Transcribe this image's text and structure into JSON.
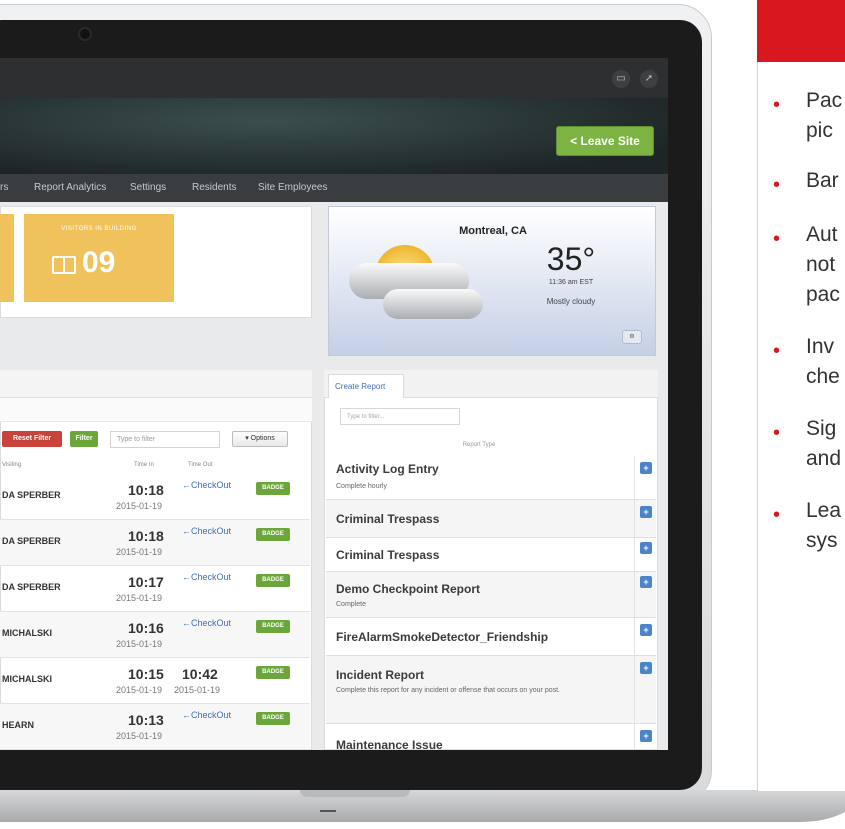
{
  "app": {
    "leave_button": "< Leave Site",
    "nav": [
      "rs",
      "Report Analytics",
      "Settings",
      "Residents",
      "Site Employees"
    ]
  },
  "stats": {
    "visitors_title": "VISITORS IN BUILDING",
    "visitors_count": "09"
  },
  "weather": {
    "city": "Montreal, CA",
    "temp": "35°",
    "time": "11:36 am EST",
    "desc": "Mostly cloudy"
  },
  "visitors": {
    "reset_filter": "Reset Filter",
    "filter": "Filter",
    "filter_placeholder": "Type to filter",
    "options": "▾ Options",
    "columns": {
      "visiting": "Visiting",
      "time_in": "Time In",
      "time_out": "Time Out"
    },
    "rows": [
      {
        "name": "DA SPERBER",
        "time_in": "10:18",
        "date_in": "2015-01-19",
        "time_out": "←CheckOut",
        "date_out": "",
        "badge": "BADGE"
      },
      {
        "name": "DA SPERBER",
        "time_in": "10:18",
        "date_in": "2015-01-19",
        "time_out": "←CheckOut",
        "date_out": "",
        "badge": "BADGE"
      },
      {
        "name": "DA SPERBER",
        "time_in": "10:17",
        "date_in": "2015-01-19",
        "time_out": "←CheckOut",
        "date_out": "",
        "badge": "BADGE"
      },
      {
        "name": "MICHALSKI",
        "time_in": "10:16",
        "date_in": "2015-01-19",
        "time_out": "←CheckOut",
        "date_out": "",
        "badge": "BADGE"
      },
      {
        "name": "MICHALSKI",
        "time_in": "10:15",
        "date_in": "2015-01-19",
        "time_out": "10:42",
        "date_out": "2015-01-19",
        "badge": "BADGE"
      },
      {
        "name": "HEARN",
        "time_in": "10:13",
        "date_in": "2015-01-19",
        "time_out": "←CheckOut",
        "date_out": "",
        "badge": "BADGE"
      }
    ]
  },
  "reports": {
    "tab": "Create Report",
    "filter_placeholder": "Type to filter...",
    "column": "Report Type",
    "items": [
      {
        "title": "Activity Log Entry",
        "sub": "Complete hourly"
      },
      {
        "title": "Criminal Trespass",
        "sub": ""
      },
      {
        "title": "Criminal Trespass",
        "sub": ""
      },
      {
        "title": "Demo Checkpoint Report",
        "sub": "Complete"
      },
      {
        "title": "FireAlarmSmokeDetector_Friendship",
        "sub": ""
      },
      {
        "title": "Incident Report",
        "sub": "Complete this report for any incident or offense that occurs on your post."
      },
      {
        "title": "Maintenance Issue",
        "sub": ""
      }
    ]
  },
  "card": {
    "bullets": [
      "Pac",
      "pic",
      "Bar",
      "Aut",
      "not",
      "pac",
      "Inv",
      "che",
      "Sig",
      "and",
      "Lea",
      "sys"
    ]
  },
  "colors": {
    "accent_red": "#d8171e",
    "badge_green": "#6aa63a",
    "stat_yellow": "#f0c25c"
  }
}
